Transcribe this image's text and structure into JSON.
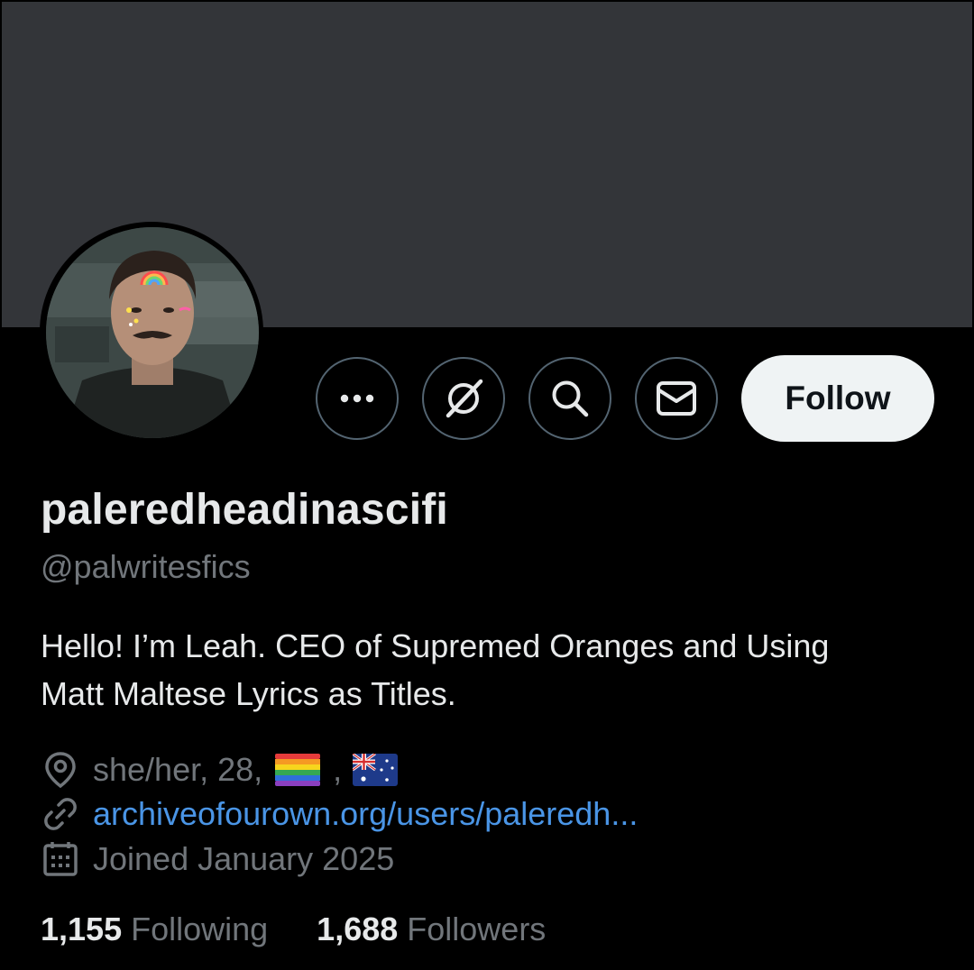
{
  "profile": {
    "display_name": "paleredheadinascifi",
    "handle": "@palwritesfics",
    "bio_line1": "Hello! I’m Leah. CEO of Supremed Oranges and Using",
    "bio_line2": "Matt Maltese Lyrics as Titles.",
    "location_text": "she/her, 28, ",
    "location_sep": ",",
    "link_text": "archiveofourown.org/users/paleredh...",
    "joined_text": "Joined January 2025"
  },
  "actions": {
    "more_icon": "more-dots-icon",
    "grok_icon": "grok-icon",
    "search_icon": "search-icon",
    "message_icon": "envelope-icon",
    "follow_label": "Follow"
  },
  "stats": {
    "following_count": "1,155",
    "following_label": "Following",
    "followers_count": "1,688",
    "followers_label": "Followers"
  },
  "colors": {
    "background": "#000000",
    "banner": "#333539",
    "text_primary": "#e7e9ea",
    "text_secondary": "#71767b",
    "link": "#4a95e6",
    "button_border": "#536471",
    "follow_bg": "#eff3f4"
  },
  "icons": {
    "location": "location-pin-icon",
    "link": "link-icon",
    "calendar": "calendar-icon",
    "pride_flag": "rainbow-flag-icon",
    "australia_flag": "australia-flag-icon"
  }
}
